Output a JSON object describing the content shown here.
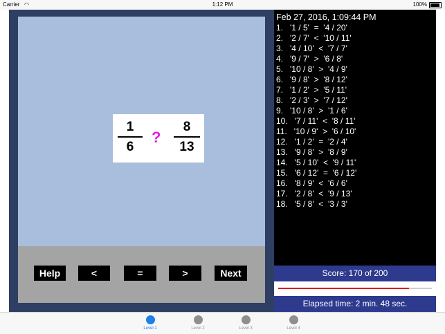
{
  "status": {
    "carrier": "Carrier",
    "wifi_icon": "wifi-icon",
    "time": "1:12 PM",
    "battery": "100%"
  },
  "problem": {
    "left_num": "1",
    "left_den": "6",
    "symbol": "?",
    "right_num": "8",
    "right_den": "13",
    "symbol_color": "#e020e0"
  },
  "controls": {
    "help": "Help",
    "less": "<",
    "equal": "=",
    "greater": ">",
    "next": "Next"
  },
  "log": {
    "header": "Feb 27, 2016, 1:09:44 PM",
    "entries": [
      "1.   '1 / 5'  =  '4 / 20'",
      "2.   '2 / 7'  <  '10 / 11'",
      "3.   '4 / 10'  <  '7 / 7'",
      "4.   '9 / 7'  >  '6 / 8'",
      "5.   '10 / 8'  >  '4 / 9'",
      "6.   '9 / 8'  >  '8 / 12'",
      "7.   '1 / 2'  >  '5 / 11'",
      "8.   '2 / 3'  >  '7 / 12'",
      "9.   '10 / 8'  >  '1 / 6'",
      "10.   '7 / 11'  <  '8 / 11'",
      "11.   '10 / 9'  >  '6 / 10'",
      "12.   '1 / 2'  =  '2 / 4'",
      "13.   '9 / 8'  >  '8 / 9'",
      "14.   '5 / 10'  <  '9 / 11'",
      "15.   '6 / 12'  =  '6 / 12'",
      "16.   '8 / 9'  <  '6 / 6'",
      "17.   '2 / 8'  <  '9 / 13'",
      "18.   '5 / 8'  <  '3 / 3'"
    ]
  },
  "score": {
    "text": "Score: 170 of 200",
    "progress_fraction": 0.85,
    "progress_color": "#e01818"
  },
  "elapsed": "Elapsed time: 2 min.  48 sec.",
  "tabs": [
    {
      "label": "Level 1",
      "active": true
    },
    {
      "label": "Level 2",
      "active": false
    },
    {
      "label": "Level 3",
      "active": false
    },
    {
      "label": "Level 4",
      "active": false
    }
  ]
}
